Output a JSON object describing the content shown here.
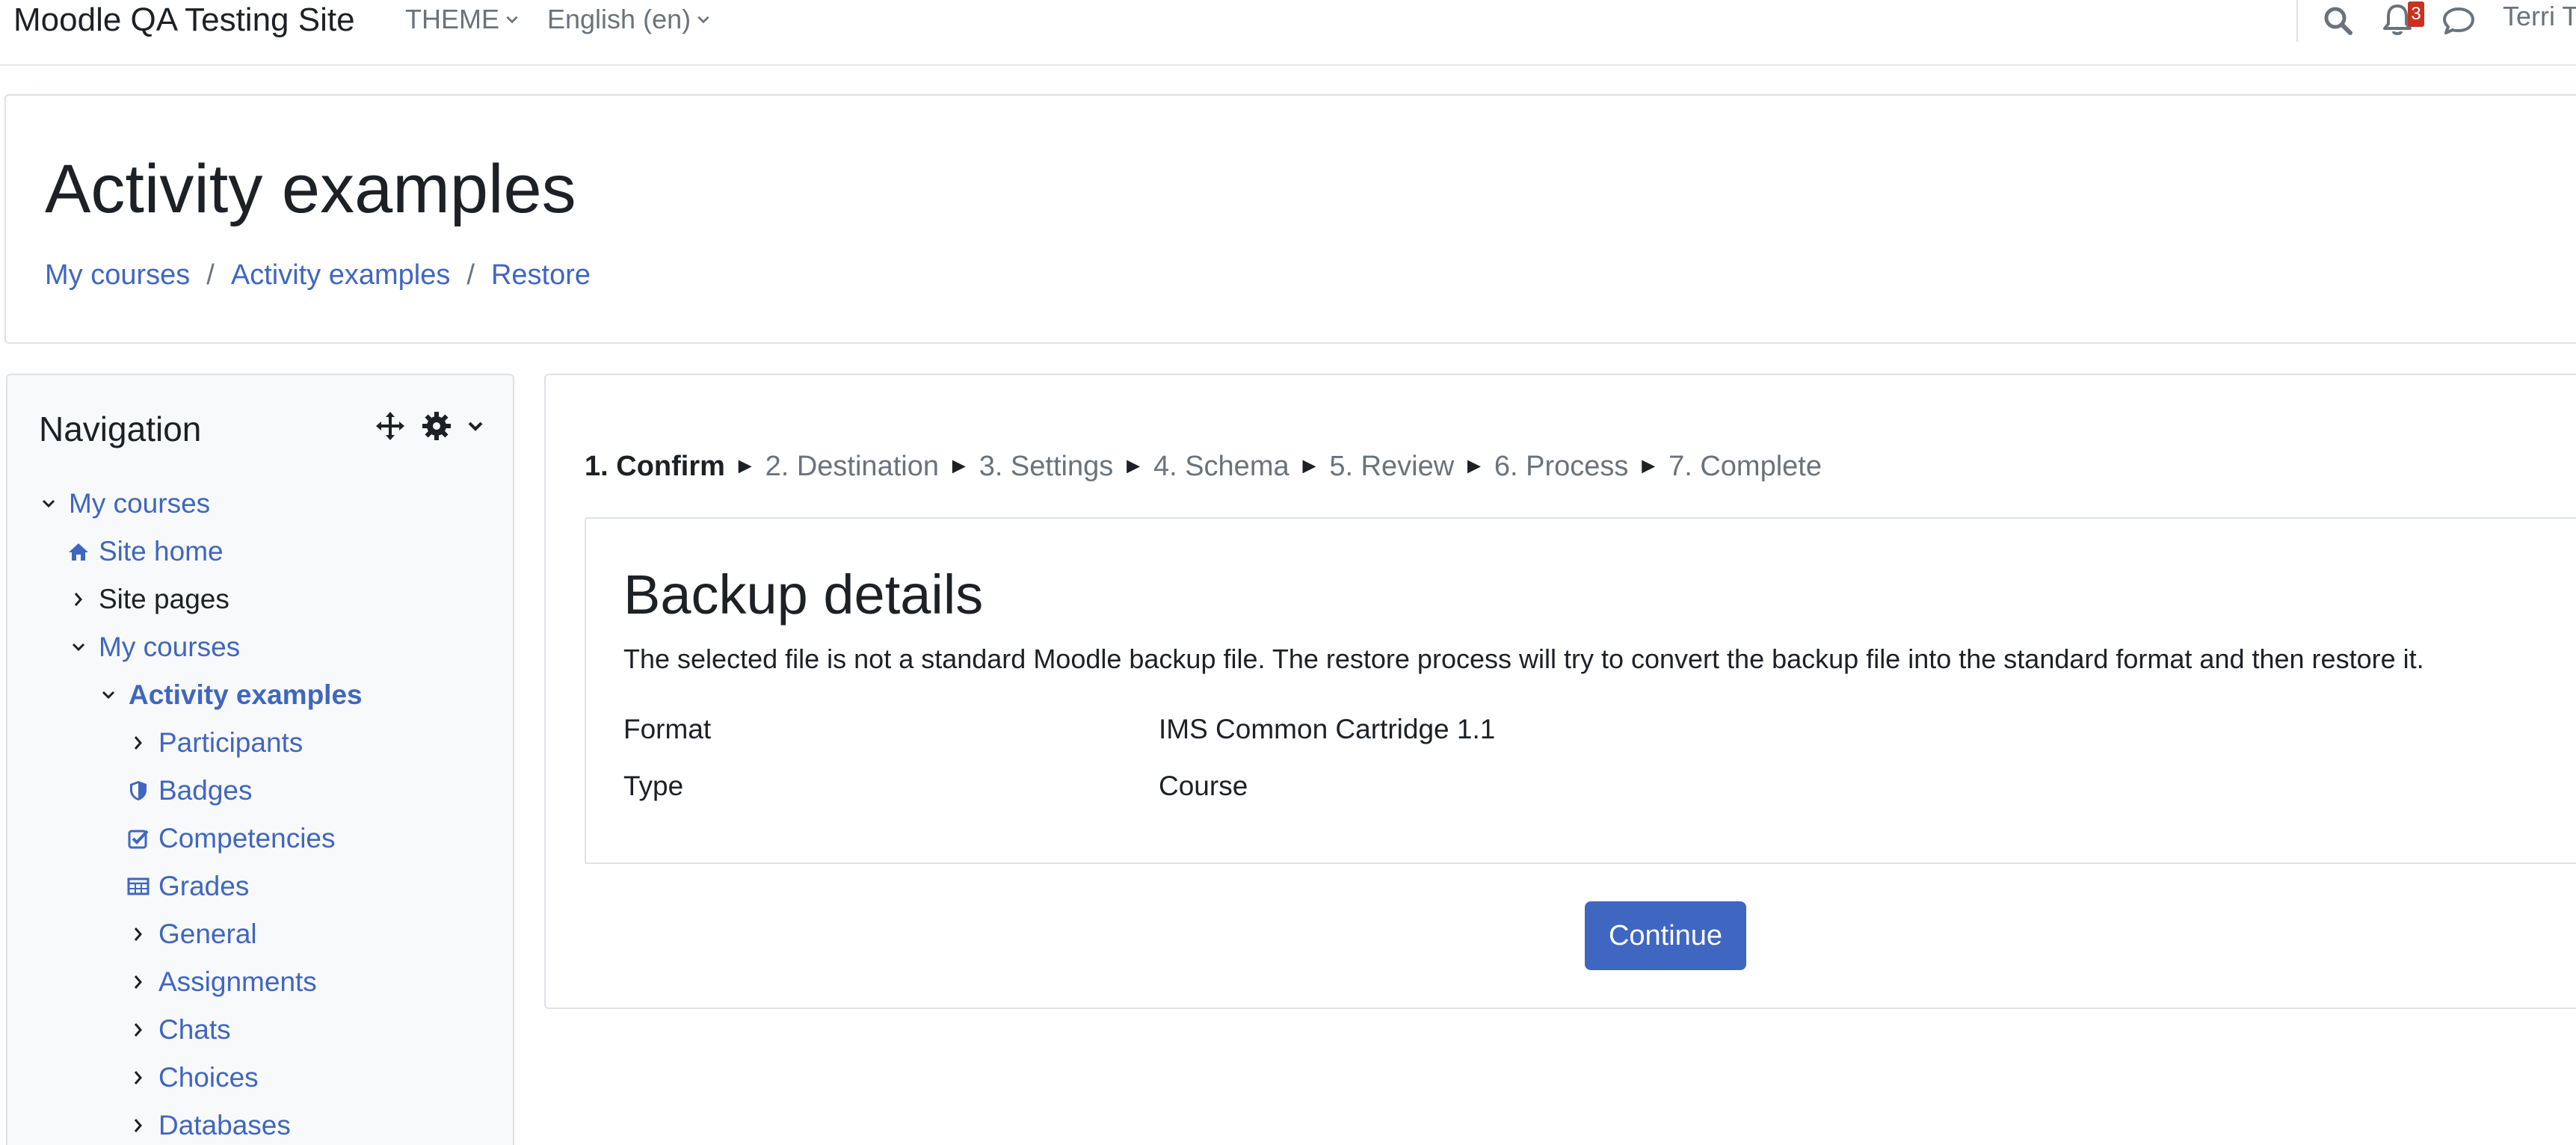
{
  "navbar": {
    "site_name": "Moodle QA Testing Site",
    "theme_label": "THEME",
    "language_label": "English (en)",
    "notification_count": "3",
    "user_name": "Terri T"
  },
  "header": {
    "title": "Activity examples",
    "breadcrumb": [
      "My courses",
      "Activity examples",
      "Restore"
    ],
    "separator": "/"
  },
  "navigation": {
    "title": "Navigation",
    "items": [
      {
        "label": "My courses",
        "icon": "chevron-down-icon"
      },
      {
        "label": "Site home",
        "icon": "home-icon"
      },
      {
        "label": "Site pages",
        "icon": "chevron-right-icon"
      },
      {
        "label": "My courses",
        "icon": "chevron-down-icon"
      },
      {
        "label": "Activity examples",
        "icon": "chevron-down-icon"
      },
      {
        "label": "Participants",
        "icon": "chevron-right-icon"
      },
      {
        "label": "Badges",
        "icon": "shield-icon"
      },
      {
        "label": "Competencies",
        "icon": "check-square-icon"
      },
      {
        "label": "Grades",
        "icon": "table-icon"
      },
      {
        "label": "General",
        "icon": "chevron-right-icon"
      },
      {
        "label": "Assignments",
        "icon": "chevron-right-icon"
      },
      {
        "label": "Chats",
        "icon": "chevron-right-icon"
      },
      {
        "label": "Choices",
        "icon": "chevron-right-icon"
      },
      {
        "label": "Databases",
        "icon": "chevron-right-icon"
      }
    ]
  },
  "stages": {
    "arrow": "►",
    "items": [
      "1. Confirm",
      "2. Destination",
      "3. Settings",
      "4. Schema",
      "5. Review",
      "6. Process",
      "7. Complete"
    ]
  },
  "backup_details": {
    "title": "Backup details",
    "description": "The selected file is not a standard Moodle backup file. The restore process will try to convert the backup file into the standard format and then restore it.",
    "rows": [
      {
        "key": "Format",
        "value": "IMS Common Cartridge 1.1"
      },
      {
        "key": "Type",
        "value": "Course"
      }
    ]
  },
  "actions": {
    "continue_label": "Continue"
  },
  "colors": {
    "link": "#3f66c0",
    "primary_button": "#3f66c0",
    "badge": "#ca3120",
    "muted_text": "#6a737b"
  }
}
